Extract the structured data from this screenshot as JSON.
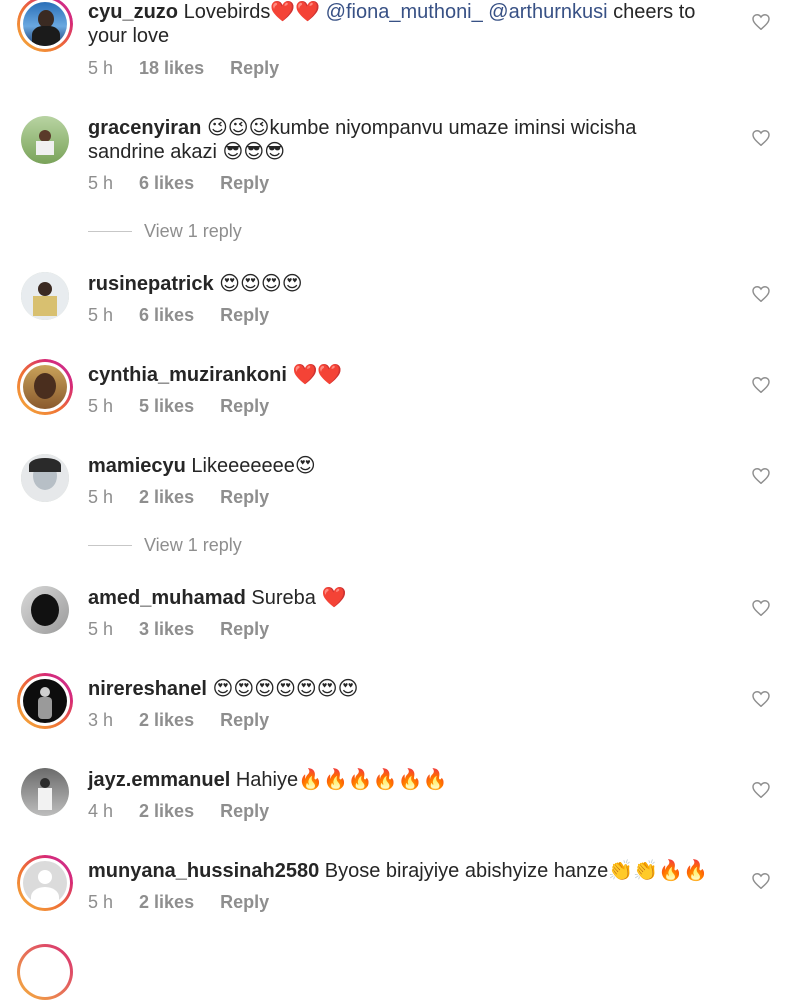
{
  "comments": [
    {
      "username": "cyu_zuzo",
      "parts": [
        {
          "t": "Lovebirds",
          "c": "text"
        },
        {
          "t": "❤️❤️",
          "c": "emoji"
        },
        {
          "t": " @fiona_muthoni_ @arthurnkusi",
          "c": "mention"
        },
        {
          "t": " cheers to your love",
          "c": "text"
        }
      ],
      "time": "5 h",
      "likes": "18 likes",
      "reply": "Reply"
    },
    {
      "username": "gracenyiran",
      "parts": [
        {
          "t": "😉😉😉",
          "c": "emoji"
        },
        {
          "t": "kumbe niyompanvu umaze iminsi wicisha sandrine akazi ",
          "c": "text"
        },
        {
          "t": "😎😎😎",
          "c": "emoji"
        }
      ],
      "time": "5 h",
      "likes": "6 likes",
      "reply": "Reply",
      "view_reply": "View 1 reply"
    },
    {
      "username": "rusinepatrick",
      "parts": [
        {
          "t": "😍😍😍😍",
          "c": "emoji"
        }
      ],
      "time": "5 h",
      "likes": "6 likes",
      "reply": "Reply"
    },
    {
      "username": "cynthia_muzirankoni",
      "parts": [
        {
          "t": "❤️❤️",
          "c": "emoji"
        }
      ],
      "time": "5 h",
      "likes": "5 likes",
      "reply": "Reply"
    },
    {
      "username": "mamiecyu",
      "parts": [
        {
          "t": "Likeeeeeee",
          "c": "text"
        },
        {
          "t": "😍",
          "c": "emoji"
        }
      ],
      "time": "5 h",
      "likes": "2 likes",
      "reply": "Reply",
      "view_reply": "View 1 reply"
    },
    {
      "username": "amed_muhamad",
      "parts": [
        {
          "t": "Sureba ",
          "c": "text"
        },
        {
          "t": "❤️",
          "c": "emoji"
        }
      ],
      "time": "5 h",
      "likes": "3 likes",
      "reply": "Reply"
    },
    {
      "username": "nirereshanel",
      "parts": [
        {
          "t": "😍😍😍😍😍😍😍",
          "c": "emoji"
        }
      ],
      "time": "3 h",
      "likes": "2 likes",
      "reply": "Reply"
    },
    {
      "username": "jayz.emmanuel",
      "parts": [
        {
          "t": "Hahiye",
          "c": "text"
        },
        {
          "t": "🔥🔥🔥🔥🔥🔥",
          "c": "emoji"
        }
      ],
      "time": "4 h",
      "likes": "2 likes",
      "reply": "Reply"
    },
    {
      "username": "munyana_hussinah2580",
      "parts": [
        {
          "t": "Byose birajyiye abishyize hanze",
          "c": "text"
        },
        {
          "t": "👏👏🔥🔥",
          "c": "emoji"
        }
      ],
      "time": "5 h",
      "likes": "2 likes",
      "reply": "Reply"
    }
  ],
  "icons": {
    "like": "heart-outline-icon"
  },
  "colors": {
    "mention": "#385185",
    "meta": "#8e8e8e",
    "story_ring": "#d62976"
  }
}
